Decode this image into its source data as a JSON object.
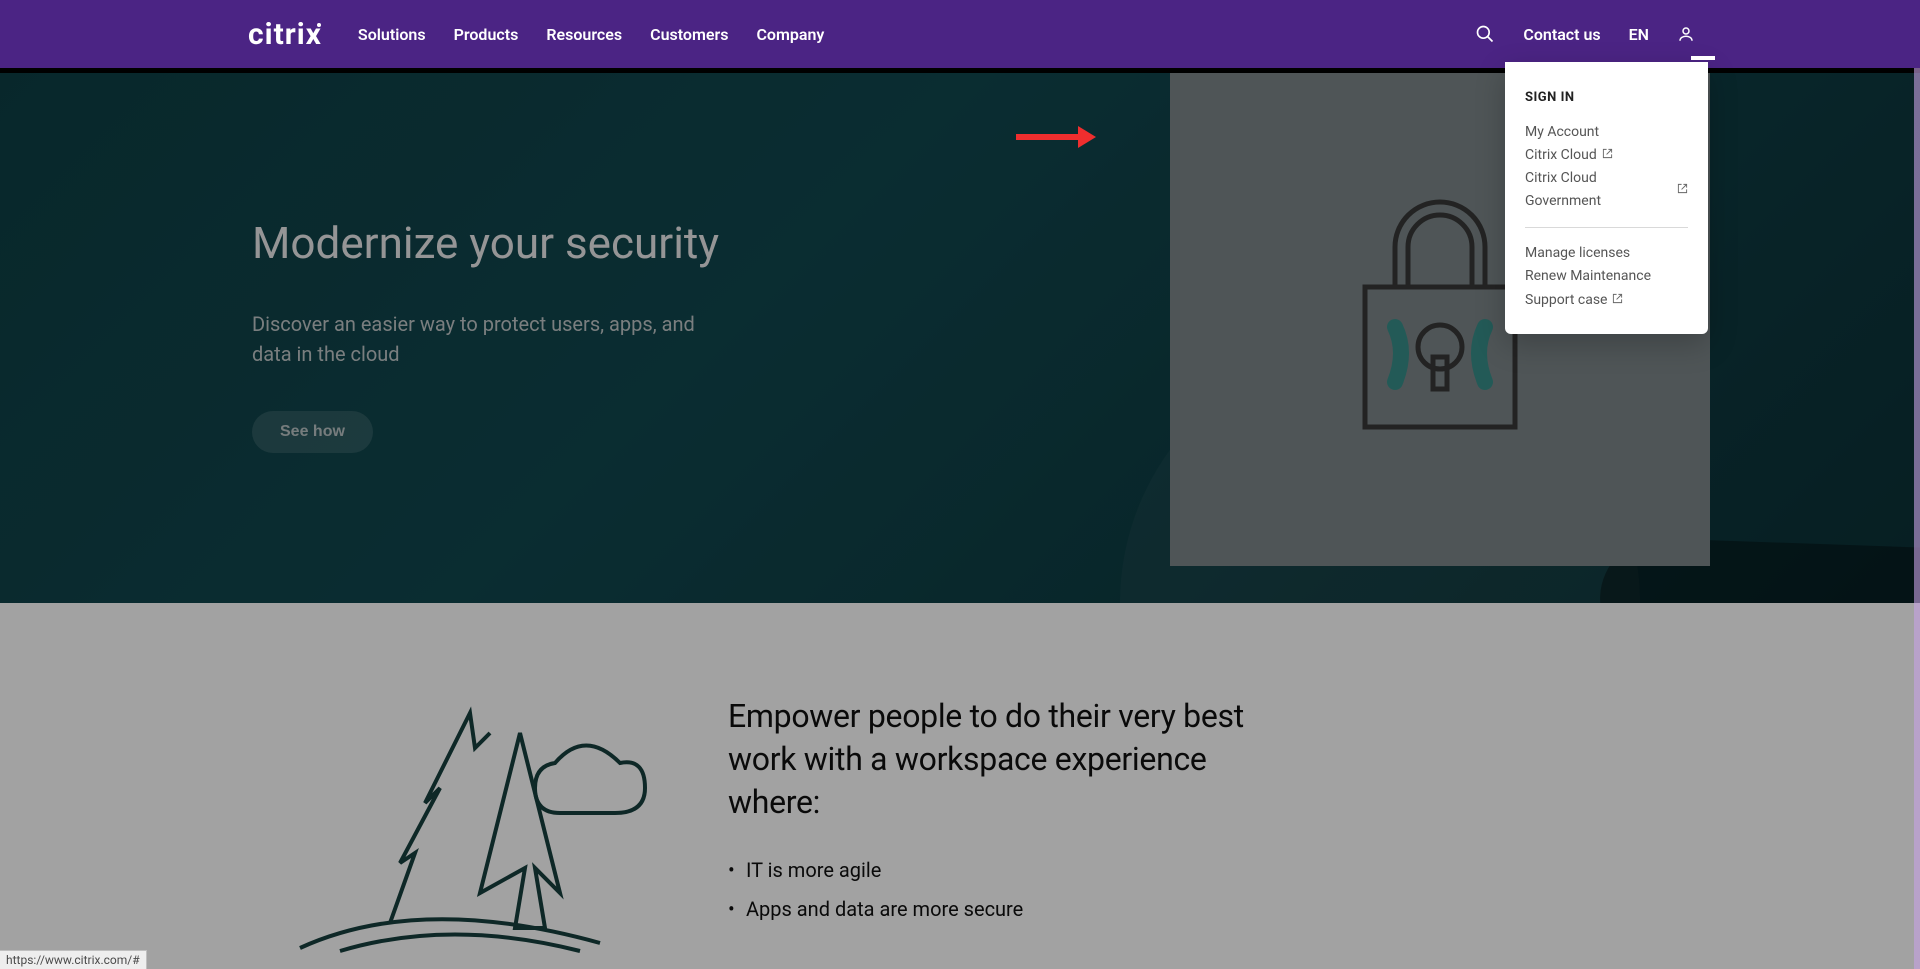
{
  "header": {
    "logo_text": "citrix",
    "nav": [
      "Solutions",
      "Products",
      "Resources",
      "Customers",
      "Company"
    ],
    "contact_label": "Contact us",
    "lang_label": "EN"
  },
  "dropdown": {
    "title": "SIGN IN",
    "primary": [
      {
        "label": "My Account",
        "external": false
      },
      {
        "label": "Citrix Cloud",
        "external": true
      },
      {
        "label": "Citrix Cloud Government",
        "external": true
      }
    ],
    "secondary": [
      {
        "label": "Manage licenses",
        "external": false
      },
      {
        "label": "Renew Maintenance",
        "external": false
      },
      {
        "label": "Support case",
        "external": true
      }
    ]
  },
  "hero": {
    "title": "Modernize your security",
    "subtitle": "Discover an easier way to protect users, apps, and data in the cloud",
    "button": "See how"
  },
  "empower": {
    "title": "Empower people to do their very best work with a workspace experience where:",
    "bullets": [
      "IT is more agile",
      "Apps and data are more secure"
    ]
  },
  "status_url": "https://www.citrix.com/#"
}
